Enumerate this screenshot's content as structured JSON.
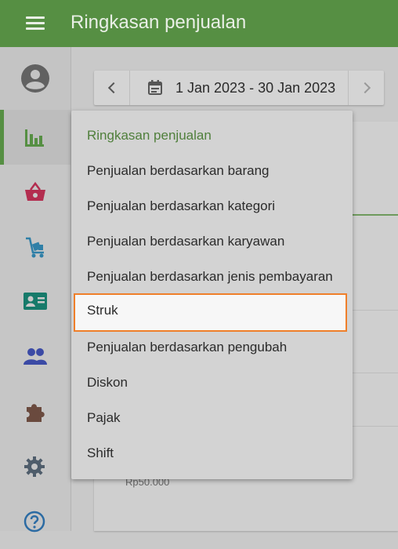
{
  "app": {
    "title": "Ringkasan penjualan",
    "brand_color": "#568f43",
    "highlight_color": "#ef7f2a"
  },
  "sidebar": {
    "items": [
      {
        "name": "reports",
        "icon": "bar-chart-icon",
        "active": true,
        "color": "#568f43"
      },
      {
        "name": "items",
        "icon": "basket-icon",
        "active": false,
        "color": "#b32d4f"
      },
      {
        "name": "inventory",
        "icon": "cart-icon",
        "active": false,
        "color": "#2f7fa7"
      },
      {
        "name": "customers",
        "icon": "id-card-icon",
        "active": false,
        "color": "#167a6a"
      },
      {
        "name": "employees",
        "icon": "people-icon",
        "active": false,
        "color": "#3b4aa5"
      },
      {
        "name": "integrations",
        "icon": "puzzle-icon",
        "active": false,
        "color": "#6a4a3e"
      },
      {
        "name": "settings",
        "icon": "gear-icon",
        "active": false,
        "color": "#4f5d6b"
      },
      {
        "name": "help",
        "icon": "help-icon",
        "active": false,
        "color": "#2c6ba3"
      }
    ]
  },
  "date_picker": {
    "range_label": "1 Jan 2023 - 30 Jan 2023"
  },
  "card": {
    "amount": "Rp50.000"
  },
  "report_menu": {
    "items": [
      {
        "label": "Ringkasan penjualan",
        "state": "current"
      },
      {
        "label": "Penjualan berdasarkan barang",
        "state": "normal"
      },
      {
        "label": "Penjualan berdasarkan kategori",
        "state": "normal"
      },
      {
        "label": "Penjualan berdasarkan karyawan",
        "state": "normal"
      },
      {
        "label": "Penjualan berdasarkan jenis pembayaran",
        "state": "normal"
      },
      {
        "label": "Struk",
        "state": "highlighted"
      },
      {
        "label": "Penjualan berdasarkan pengubah",
        "state": "normal"
      },
      {
        "label": "Diskon",
        "state": "normal"
      },
      {
        "label": "Pajak",
        "state": "normal"
      },
      {
        "label": "Shift",
        "state": "normal"
      }
    ]
  }
}
